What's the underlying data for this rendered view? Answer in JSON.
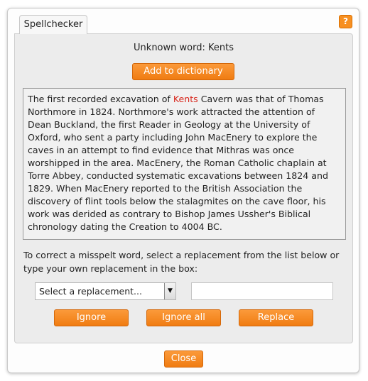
{
  "dialog": {
    "tab_label": "Spellchecker",
    "help_label": "?",
    "unknown_word_text": "Unknown word: Kents",
    "add_to_dictionary_label": "Add to dictionary",
    "passage": {
      "before": "The first recorded excavation of ",
      "misspelt_word": "Kents",
      "after": " Cavern was that of Thomas Northmore in 1824. Northmore's work attracted the attention of Dean Buckland, the first Reader in Geology at the University of Oxford, who sent a party including John MacEnery to explore the caves in an attempt to find evidence that Mithras was once worshipped in the area. MacEnery, the Roman Catholic chaplain at Torre Abbey, conducted systematic excavations between 1824 and 1829. When MacEnery reported to the British Association the discovery of flint tools below the stalagmites on the cave floor, his work was derided as contrary to Bishop James Ussher's Biblical chronology dating the Creation to 4004 BC."
    },
    "instructions": "To correct a misspelt word, select a replacement from the list below or type your own replacement in the box:",
    "replacement_select": {
      "selected": "Select a replacement..."
    },
    "replacement_input": {
      "value": "",
      "placeholder": ""
    },
    "ignore_label": "Ignore",
    "ignore_all_label": "Ignore all",
    "replace_label": "Replace",
    "close_label": "Close"
  },
  "colors": {
    "accent": "#f7881f",
    "misspelt": "#d8261c",
    "panel_bg": "#ececec"
  },
  "icons": {
    "help": "help-icon",
    "dropdown": "chevron-down-icon"
  }
}
